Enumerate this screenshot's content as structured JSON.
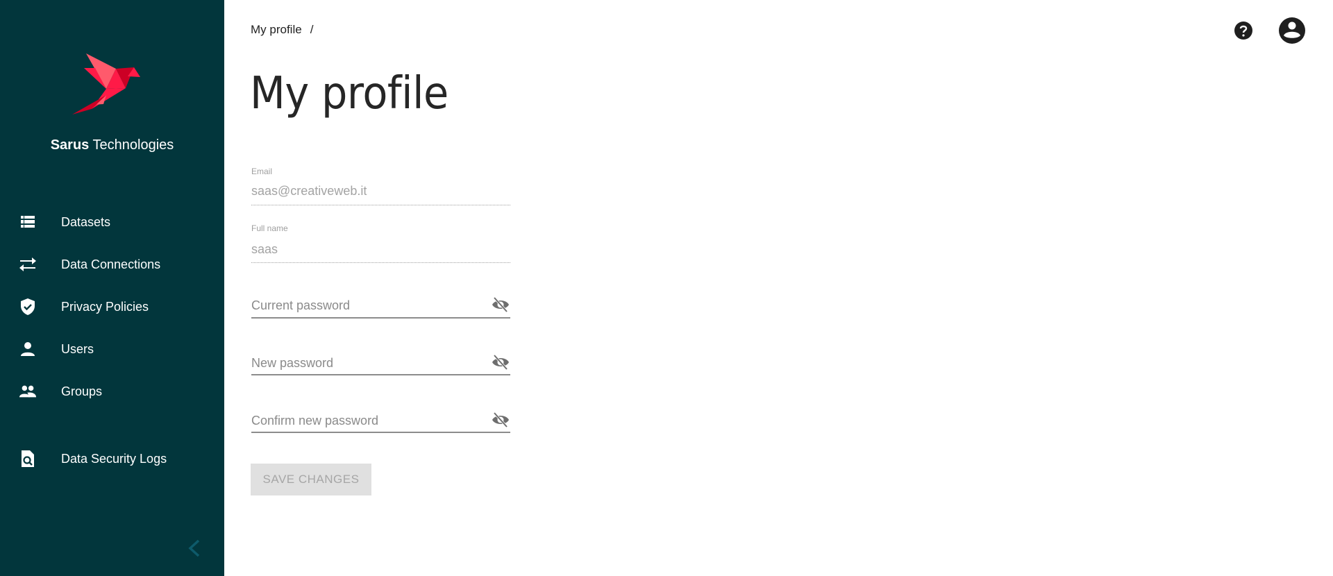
{
  "sidebar": {
    "brand_bold": "Sarus",
    "brand_rest": " Technologies",
    "items": [
      {
        "label": "Datasets",
        "icon": "list-icon"
      },
      {
        "label": "Data Connections",
        "icon": "swap-arrows-icon"
      },
      {
        "label": "Privacy Policies",
        "icon": "shield-check-icon"
      },
      {
        "label": "Users",
        "icon": "person-icon"
      },
      {
        "label": "Groups",
        "icon": "people-icon"
      },
      {
        "label": "Data Security Logs",
        "icon": "file-search-icon"
      }
    ],
    "collapse_icon": "chevron-left-icon"
  },
  "header": {
    "breadcrumb": "My profile",
    "breadcrumb_separator": "/",
    "help_icon": "help-circle-icon",
    "account_icon": "account-circle-icon"
  },
  "page": {
    "title": "My profile"
  },
  "form": {
    "email": {
      "label": "Email",
      "value": "saas@creativeweb.it"
    },
    "full_name": {
      "label": "Full name",
      "value": "saas"
    },
    "current_password": {
      "placeholder": "Current password",
      "value": ""
    },
    "new_password": {
      "placeholder": "New password",
      "value": ""
    },
    "confirm_password": {
      "placeholder": "Confirm new password",
      "value": ""
    },
    "save_label": "SAVE CHANGES"
  },
  "colors": {
    "sidebar_bg": "#02363c",
    "brand_red": "#ff1a47",
    "disabled_button_bg": "#e0e0e0",
    "disabled_button_text": "#a6a6a6"
  }
}
